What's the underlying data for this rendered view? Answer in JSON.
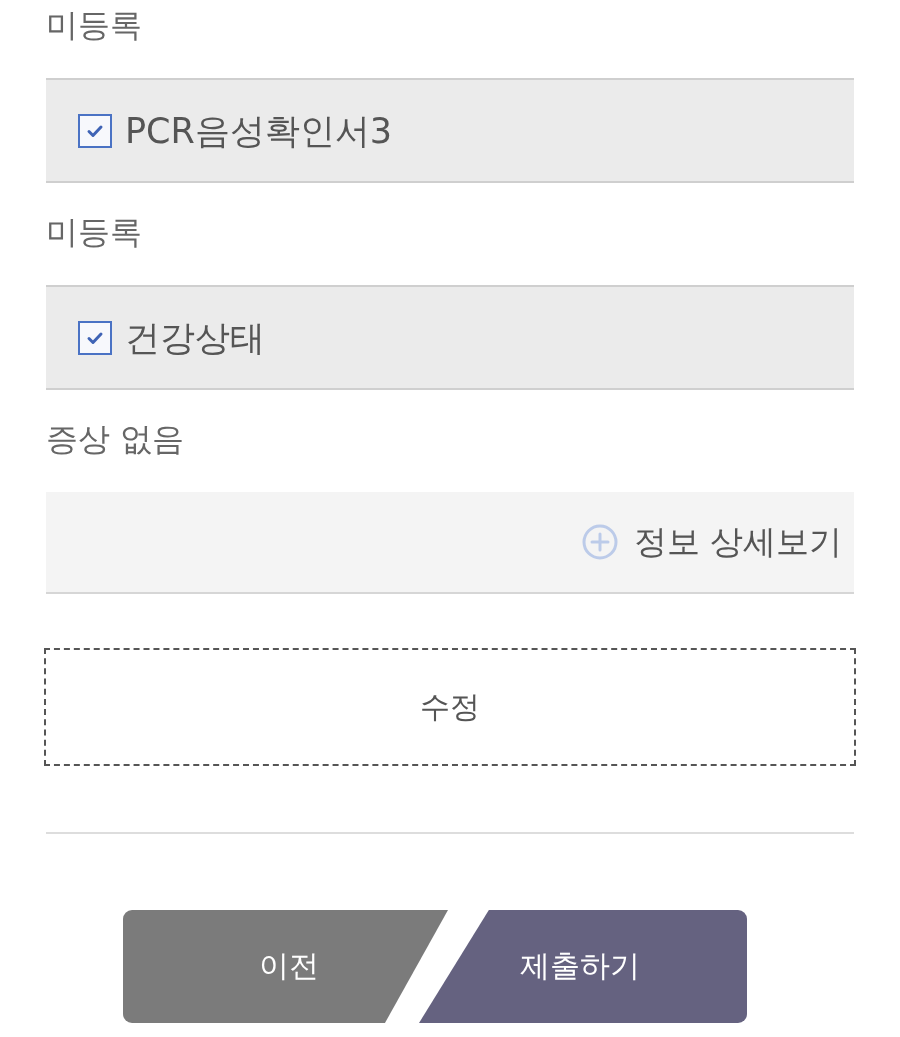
{
  "rows": [
    {
      "kind": "value",
      "text": "미등록"
    },
    {
      "kind": "check",
      "label": "PCR음성확인서3",
      "checked": true
    },
    {
      "kind": "value",
      "text": "미등록"
    },
    {
      "kind": "check",
      "label": "건강상태",
      "checked": true
    },
    {
      "kind": "value",
      "text": "증상 없음"
    },
    {
      "kind": "detail",
      "label": "정보 상세보기"
    }
  ],
  "edit_button": "수정",
  "nav": {
    "prev": "이전",
    "submit": "제출하기"
  }
}
